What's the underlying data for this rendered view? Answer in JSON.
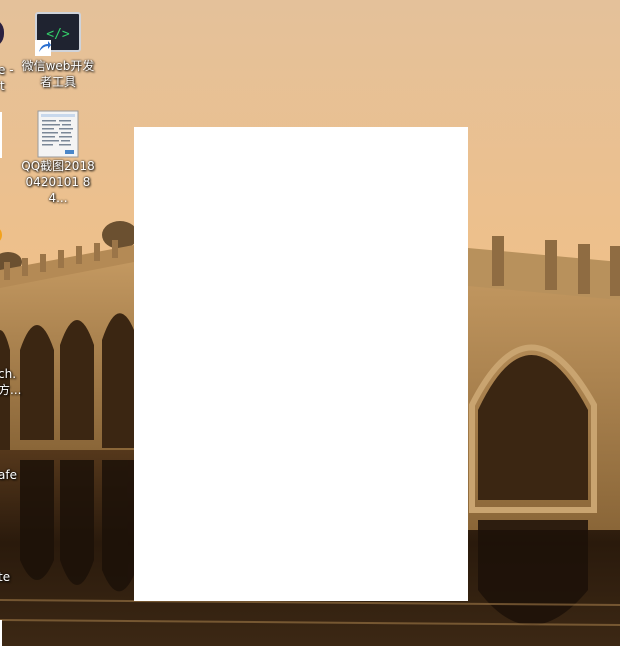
{
  "desktop_icons": [
    {
      "label": "微信web开发者工具",
      "icon": "wechat-devtools-icon",
      "shortcut": true
    },
    {
      "label": "QQ截图20180420101 84...",
      "icon": "screenshot-thumbnail-icon",
      "shortcut": false
    }
  ],
  "edge_labels": {
    "top": "e -",
    "top2": "t",
    "mid1": "ch.",
    "mid2": "方...",
    "low1": "afe",
    "low2": "te"
  },
  "colors": {
    "sky_top": "#e7c398",
    "sky_mid": "#f0c288",
    "water": "#2b1c0f",
    "accent": "#e2a25c"
  }
}
